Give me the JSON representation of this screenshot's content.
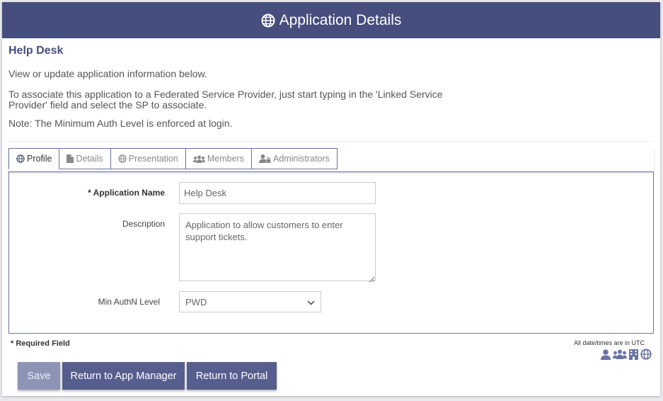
{
  "header": {
    "title": "Application Details",
    "icon": "globe-icon"
  },
  "app": {
    "name": "Help Desk"
  },
  "intro": {
    "line1": "View or update application information below.",
    "line2": "To associate this application to a Federated Service Provider, just start typing in the 'Linked Service Provider' field and select the SP to associate.",
    "line3": "Note: The Minimum Auth Level is enforced at login."
  },
  "tabs": [
    {
      "label": "Profile",
      "icon": "globe-icon",
      "active": true
    },
    {
      "label": "Details",
      "icon": "document-icon"
    },
    {
      "label": "Presentation",
      "icon": "globe-icon"
    },
    {
      "label": "Members",
      "icon": "users-icon"
    },
    {
      "label": "Administrators",
      "icon": "user-lock-icon"
    }
  ],
  "form": {
    "name_label": "* Application Name",
    "name_value": "Help Desk",
    "description_label": "Description",
    "description_value": "Application to allow customers to enter support tickets.",
    "authn_label": "Min AuthN Level",
    "authn_value": "PWD"
  },
  "footer": {
    "required_note": "* Required Field",
    "utc_note": "All date/times are in UTC",
    "icons": [
      "user-icon",
      "users-icon",
      "building-icon",
      "globe-icon"
    ]
  },
  "buttons": {
    "save": "Save",
    "app_manager": "Return to App Manager",
    "portal": "Return to Portal"
  },
  "colors": {
    "brand": "#454e7c",
    "button": "#565e8e",
    "button_disabled": "#8e94b5"
  }
}
